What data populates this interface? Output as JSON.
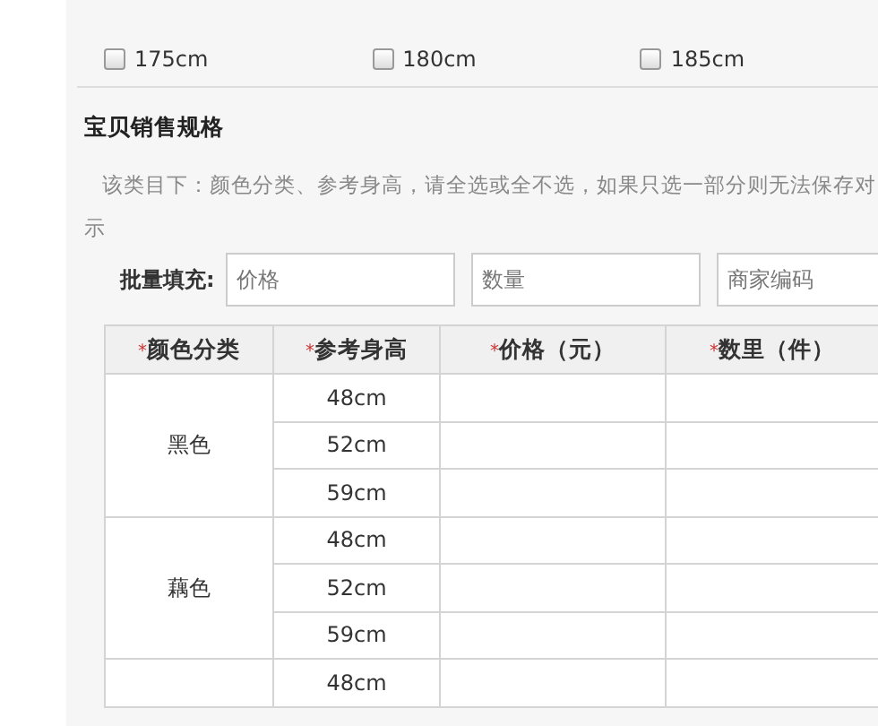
{
  "size_options": [
    {
      "label": "175cm",
      "checked": false
    },
    {
      "label": "180cm",
      "checked": false
    },
    {
      "label": "185cm",
      "checked": false
    }
  ],
  "section_title": "宝贝销售规格",
  "hint": [
    "该类目下：颜色分类、参考身高，请全选或全不选，如果只选一部分则无法保存对",
    "示"
  ],
  "batch_fill": {
    "label": "批量填充:",
    "fields": [
      {
        "placeholder": "价格"
      },
      {
        "placeholder": "数量"
      },
      {
        "placeholder": "商家编码"
      }
    ]
  },
  "table": {
    "columns": [
      {
        "mark": "*",
        "label": "颜色分类"
      },
      {
        "mark": "*",
        "label": "参考身高"
      },
      {
        "mark": "*",
        "label": "价格（元）"
      },
      {
        "mark": "*",
        "label": "数里（件）"
      }
    ],
    "groups": [
      {
        "color_name": "黑色",
        "heights": [
          "48cm",
          "52cm",
          "59cm"
        ]
      },
      {
        "color_name": "藕色",
        "heights": [
          "48cm",
          "52cm",
          "59cm"
        ]
      },
      {
        "heights": [
          "48cm"
        ]
      }
    ]
  }
}
